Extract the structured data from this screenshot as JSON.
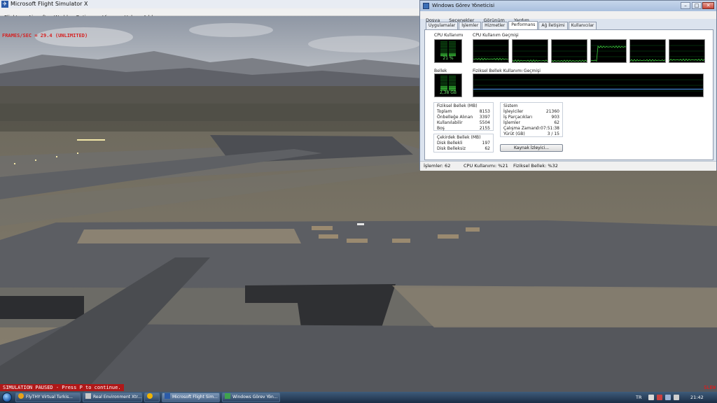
{
  "fsx": {
    "title": "Microsoft Flight Simulator X",
    "menu": [
      "Flights",
      "Aircraft",
      "World",
      "Options",
      "Views",
      "Help",
      "Add-ons"
    ],
    "fps_text": "FRAMES/SEC = 29.4  (UNLIMITED)",
    "paused_text": "SIMULATION PAUSED - Press P to continue.",
    "slew_text": "SLEW",
    "colors": {
      "overlay_red": "#d62020",
      "paused_bg": "#b01818"
    }
  },
  "task_manager": {
    "title": "Windows Görev Yöneticisi",
    "window_controls": [
      "minimize-icon",
      "maximize-icon",
      "close-icon"
    ],
    "menu": [
      "Dosya",
      "Seçenekler",
      "Görünüm",
      "Yardım"
    ],
    "tabs": [
      "Uygulamalar",
      "İşlemler",
      "Hizmetler",
      "Performans",
      "Ağ İletişimi",
      "Kullanıcılar"
    ],
    "active_tab": "Performans",
    "cpu_usage_label": "CPU Kullanımı",
    "cpu_usage_value": "21 %",
    "cpu_history_label": "CPU Kullanım Geçmişi",
    "memory_label": "Bellek",
    "memory_value": "2,38 GB",
    "memory_history_label": "Fiziksel Bellek Kullanımı Geçmişi",
    "physical_memory": {
      "title": "Fiziksel Bellek (MB)",
      "rows": [
        {
          "k": "Toplam",
          "v": "8153"
        },
        {
          "k": "Önbelleğe Alınan",
          "v": "3397"
        },
        {
          "k": "Kullanılabilir",
          "v": "5504"
        },
        {
          "k": "Boş",
          "v": "2155"
        }
      ]
    },
    "kernel_memory": {
      "title": "Çekirdek Bellek (MB)",
      "rows": [
        {
          "k": "Disk Bellekli",
          "v": "197"
        },
        {
          "k": "Disk Belleksiz",
          "v": "62"
        }
      ]
    },
    "system": {
      "title": "Sistem",
      "rows": [
        {
          "k": "İşleyiciler",
          "v": "21360"
        },
        {
          "k": "İş Parçacıkları",
          "v": "903"
        },
        {
          "k": "İşlemler",
          "v": "62"
        },
        {
          "k": "Çalışma Zamanı",
          "v": "0:07:51:38"
        },
        {
          "k": "Yürüt (GB)",
          "v": "3 / 15"
        }
      ]
    },
    "resource_monitor_button": "Kaynak İzleyici...",
    "status": {
      "processes": "İşlemler: 62",
      "cpu": "CPU Kullanımı: %21",
      "memory": "Fiziksel Bellek: %32"
    },
    "cpu_gauge_fraction": 0.21,
    "memory_gauge_fraction": 0.32,
    "graph_color": "#3fd43f"
  },
  "taskbar": {
    "buttons": [
      {
        "label": "FlyTHY Virtual Turkis...",
        "icon": "browser-icon"
      },
      {
        "label": "Real Environment Xtr...",
        "icon": "app-icon"
      },
      {
        "label": "",
        "icon": "media-player-icon"
      },
      {
        "label": "Microsoft Flight Sim...",
        "icon": "fsx-icon"
      },
      {
        "label": "Windows Görev Yön...",
        "icon": "task-manager-icon"
      }
    ],
    "tray_language": "TR",
    "clock": "21:42"
  }
}
